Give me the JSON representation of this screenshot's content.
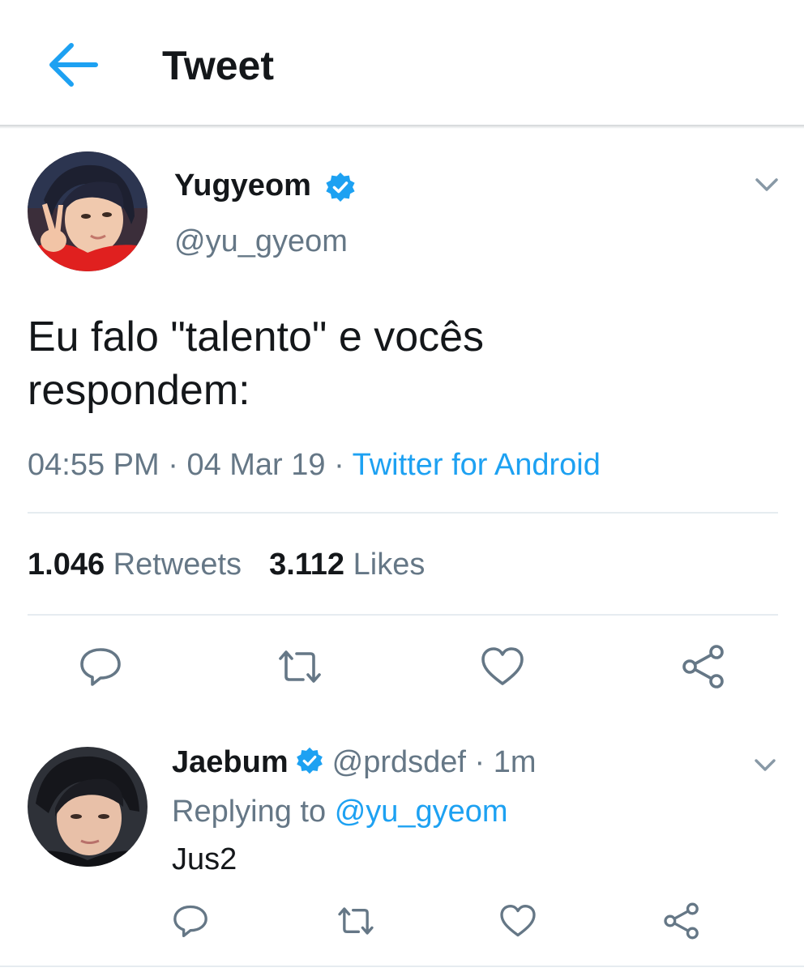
{
  "header": {
    "title": "Tweet",
    "back_icon": "arrow-left-icon"
  },
  "colors": {
    "accent": "#1da1f2",
    "secondary_text": "#657786",
    "primary_text": "#14171a",
    "divider": "#e6ecf0"
  },
  "tweet": {
    "author_name": "Yugyeom",
    "handle": "@yu_gyeom",
    "verified": true,
    "text_line1": "Eu falo \"talento\" e vocês",
    "text_line2": "respondem:",
    "time": "04:55 PM",
    "date": "04 Mar 19",
    "separator": "·",
    "source": "Twitter for Android",
    "retweets_count": "1.046",
    "retweets_label": "Retweets",
    "likes_count": "3.112",
    "likes_label": "Likes",
    "actions": [
      "reply-icon",
      "retweet-icon",
      "like-icon",
      "share-icon"
    ]
  },
  "reply": {
    "author_name": "Jaebum",
    "verified": true,
    "handle_time": "@prdsdef · 1m",
    "replying_label": "Replying to",
    "replying_to": "@yu_gyeom",
    "text": "Jus2",
    "actions": [
      "reply-icon",
      "retweet-icon",
      "like-icon",
      "share-icon"
    ]
  }
}
